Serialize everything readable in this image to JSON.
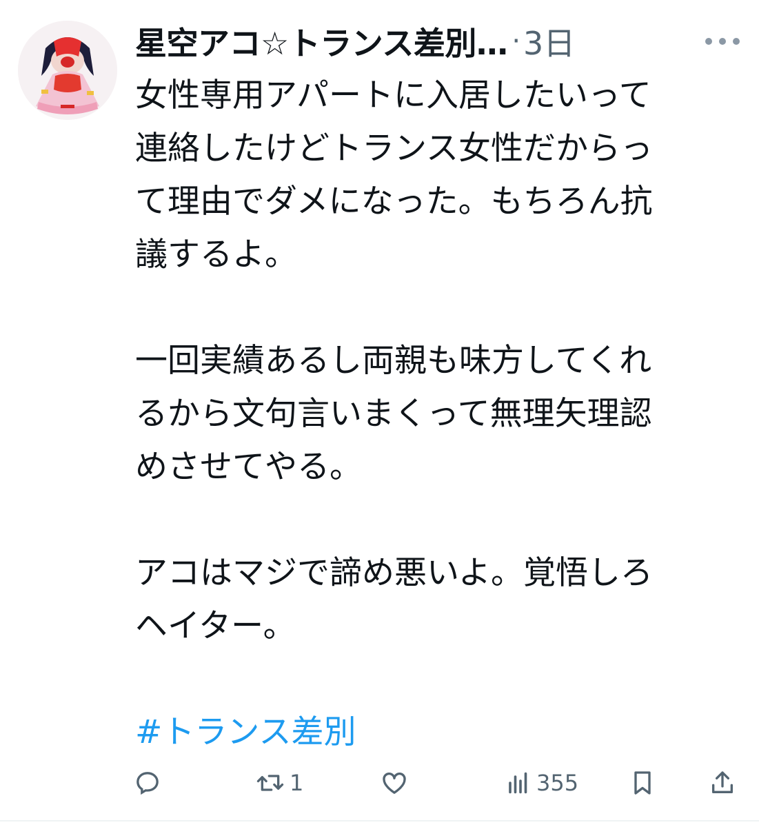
{
  "tweet": {
    "display_name": "星空アコ☆トランス差別…",
    "separator": "·",
    "timestamp": "3日",
    "paragraphs": [
      [
        "女性専用アパートに入居したいって",
        "連絡したけどトランス女性だからっ",
        "て理由でダメになった。もちろん抗",
        "議するよ。"
      ],
      [
        "一回実績あるし両親も味方してくれ",
        "るから文句言いまくって無理矢理認",
        "めさせてやる。"
      ],
      [
        "アコはマジで諦め悪いよ。覚悟しろ",
        "ヘイター。"
      ]
    ],
    "hashtag": "#トランス差別"
  },
  "actions": {
    "reply_icon": "reply-icon",
    "retweet_icon": "retweet-icon",
    "retweet_count": "1",
    "like_icon": "heart-icon",
    "views_icon": "views-icon",
    "views_count": "355",
    "bookmark_icon": "bookmark-icon",
    "share_icon": "share-icon"
  },
  "colors": {
    "text": "#0f1419",
    "secondary": "#536471",
    "link": "#1d9bf0"
  }
}
